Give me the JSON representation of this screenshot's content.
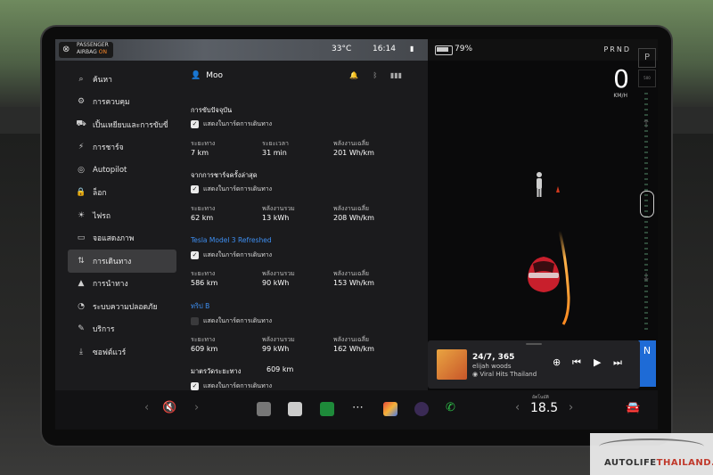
{
  "status": {
    "airbag_line1": "PASSENGER",
    "airbag_line2": "AIRBAG",
    "airbag_state": "ON",
    "temperature": "33°C",
    "time": "16:14",
    "battery_percent": "79%",
    "gears": "PRND"
  },
  "drive": {
    "speed": "0",
    "speed_unit": "KM/H",
    "gear_p": "P",
    "gear_n": "N",
    "small_label": "500"
  },
  "music": {
    "title": "24/7, 365",
    "artist": "elijah woods",
    "source": "Viral Hits Thailand"
  },
  "climate": {
    "label": "อัตโนมัติ",
    "temp": "18.5"
  },
  "nav": {
    "items": [
      {
        "label": "ค้นหา",
        "icon": "⌕"
      },
      {
        "label": "การควบคุม",
        "icon": "⚙"
      },
      {
        "label": "เปิ้นเหยียบและการขับขี่",
        "icon": "⛟"
      },
      {
        "label": "การชาร์จ",
        "icon": "⚡"
      },
      {
        "label": "Autopilot",
        "icon": "◎"
      },
      {
        "label": "ล็อก",
        "icon": "🔒"
      },
      {
        "label": "ไฟรถ",
        "icon": "☀"
      },
      {
        "label": "จอแสดงภาพ",
        "icon": "▭"
      },
      {
        "label": "การเดินทาง",
        "icon": "⇅"
      },
      {
        "label": "การนำทาง",
        "icon": "▲"
      },
      {
        "label": "ระบบความปลอดภัย",
        "icon": "◔"
      },
      {
        "label": "บริการ",
        "icon": "✎"
      },
      {
        "label": "ซอฟต์แวร์",
        "icon": "⤓"
      }
    ],
    "active_index": 8
  },
  "content": {
    "user_name": "Moo",
    "show_on_card": "แสดงในการ์ดการเดินทาง",
    "distance_label": "ระยะทาง",
    "duration_label": "ระยะเวลา",
    "total_energy_label": "พลังงานรวม",
    "avg_energy_label": "พลังงานเฉลี่ย",
    "current_drive": {
      "title": "การขับปัจจุบัน",
      "distance": "7 km",
      "duration": "31 min",
      "avg_energy": "201 Wh/km"
    },
    "since_last_charge": {
      "title": "จากการชาร์จครั้งล่าสุด",
      "distance": "62 km",
      "total_energy": "13 kWh",
      "avg_energy": "208 Wh/km"
    },
    "model": {
      "title": "Tesla Model 3 Refreshed",
      "distance": "586 km",
      "total_energy": "90 kWh",
      "avg_energy": "153 Wh/km"
    },
    "trip_b": {
      "title": "ทริป B",
      "distance": "609 km",
      "total_energy": "99 kWh",
      "avg_energy": "162 Wh/km"
    },
    "odometer": {
      "title": "มาตรวัดระยะทาง",
      "value": "609 km"
    }
  },
  "watermark": {
    "text_a": "AUTOLIFE",
    "text_b": "THAILAND.TV"
  },
  "colors": {
    "accent_blue": "#3e8ff2",
    "gear_n_blue": "#1e6bd6",
    "airbag_orange": "#ff8a2a"
  }
}
